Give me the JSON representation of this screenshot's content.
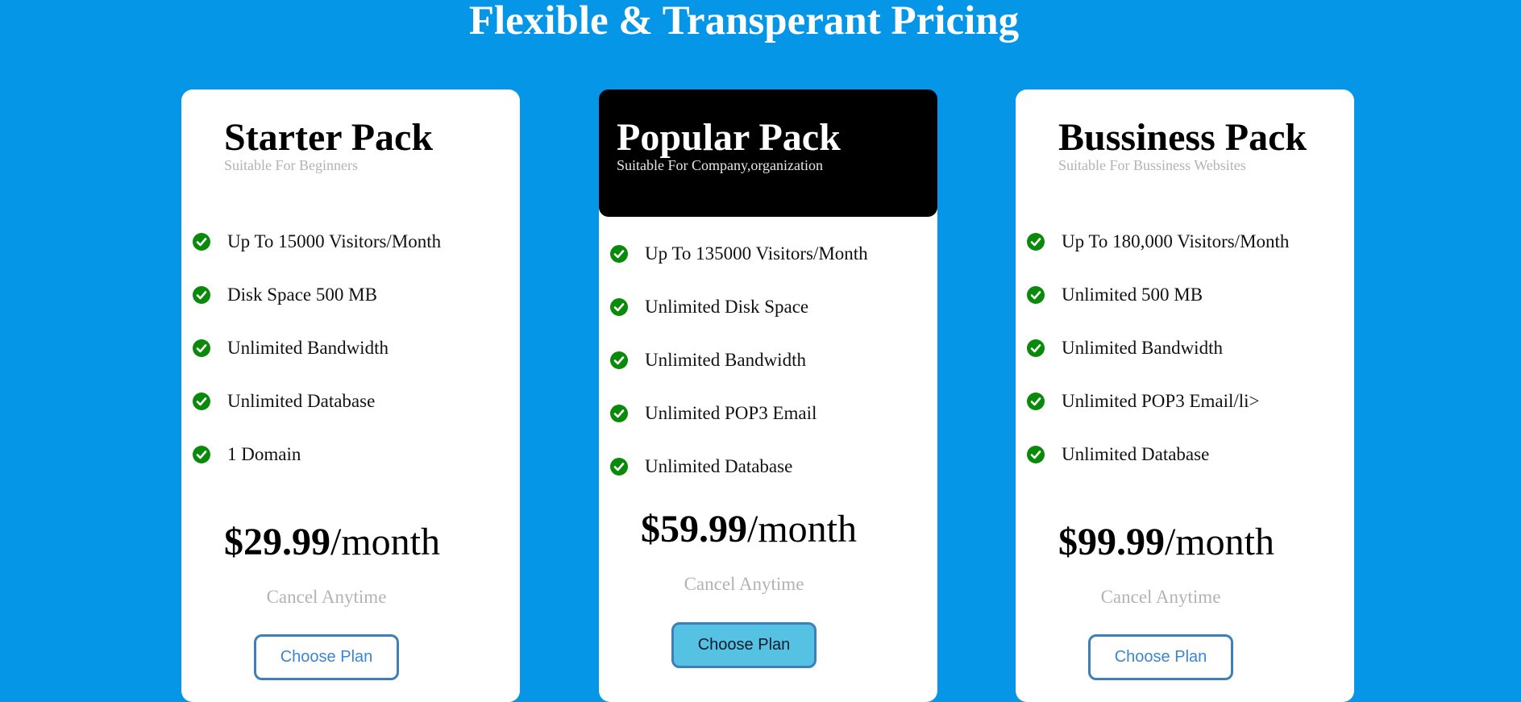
{
  "page": {
    "title": "Flexible & Transperant Pricing"
  },
  "colors": {
    "background": "#0596e8",
    "card": "#ffffff",
    "featured_header": "#000000",
    "check": "#0a8a0a",
    "button_border": "#3d7fb8",
    "button_text": "#3a86cf",
    "featured_button": "#55c2e3",
    "muted_text": "#b3b3b3"
  },
  "plans": [
    {
      "title": "Starter Pack",
      "subtitle": "Suitable For Beginners",
      "features": [
        "Up To 15000 Visitors/Month",
        "Disk Space 500 MB",
        "Unlimited Bandwidth",
        "Unlimited Database",
        "1 Domain"
      ],
      "price": "$29.99",
      "period": "/month",
      "note": "Cancel Anytime",
      "button": "Choose Plan",
      "featured": false
    },
    {
      "title": "Popular Pack",
      "subtitle": "Suitable For Company,organization",
      "features": [
        "Up To 135000 Visitors/Month",
        "Unlimited Disk Space",
        "Unlimited Bandwidth",
        "Unlimited POP3 Email",
        "Unlimited Database"
      ],
      "price": "$59.99",
      "period": "/month",
      "note": "Cancel Anytime",
      "button": "Choose Plan",
      "featured": true
    },
    {
      "title": "Bussiness Pack",
      "subtitle": "Suitable For Bussiness Websites",
      "features": [
        "Up To 180,000 Visitors/Month",
        "Unlimited 500 MB",
        "Unlimited Bandwidth",
        "Unlimited POP3 Email/li>",
        "Unlimited Database"
      ],
      "price": "$99.99",
      "period": "/month",
      "note": "Cancel Anytime",
      "button": "Choose Plan",
      "featured": false
    }
  ],
  "icons": {
    "feature_bullet": "check-circle-icon"
  }
}
